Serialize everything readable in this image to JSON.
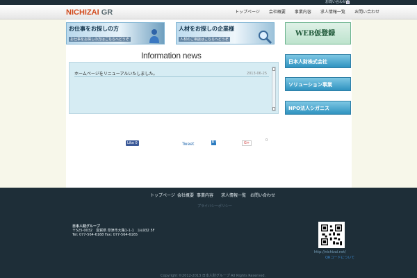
{
  "topbar": {
    "link": "お問い合わせ先"
  },
  "header": {
    "logo_main": "NICHIZAI",
    "logo_suffix": " GR",
    "nav": [
      "トップページ",
      "会社概要",
      "事業内容",
      "求人情報一覧",
      "お問い合わせ"
    ]
  },
  "banners": {
    "job_title": "お仕事をお探しの方",
    "job_sub": "お仕事をお探しの方はこちらへどうぞ",
    "company_title": "人材をお探しの企業様",
    "company_sub": "人材のご相談はこちらへどうぞ",
    "web_title": "WEB仮登録"
  },
  "info": {
    "title": "Information news",
    "items": [
      {
        "text": "ホームページをリニューアルいたしました。",
        "date": "2013-06-25"
      }
    ]
  },
  "sidebar": [
    "日本人財株式会社",
    "ソリューション事業",
    "NPO法人シガニス"
  ],
  "social": {
    "facebook": "Like 0",
    "twitter": "Tweet",
    "hatena": "B!",
    "gplus": "G+",
    "extra": "0"
  },
  "footer": {
    "nav": [
      "トップページ",
      "会社概要",
      "事業内容",
      "求人情報一覧",
      "お問い合わせ"
    ],
    "sub": "プライバシーポリシー",
    "company_name": "日本人財グループ",
    "address": "〒525-0032　滋賀県 草津市大路1-1-1　ｴﾙﾑ932 5F",
    "tel": "Tel: 077-564-6168 Fax: 077-564-6165",
    "qr_url": "http://nichizai.net/",
    "qr_link": "QRコードについて",
    "copyright": "Copyright ©2012-2013 日本人財グループ All Rights Reserved."
  }
}
